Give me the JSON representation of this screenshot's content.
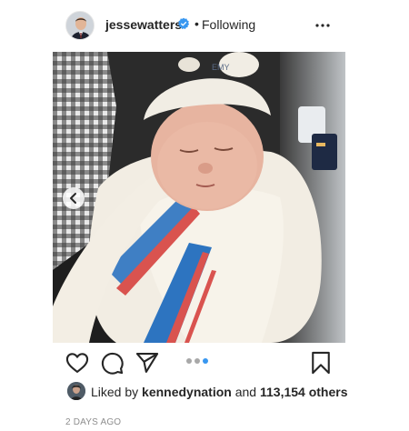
{
  "post": {
    "username": "jessewatters",
    "separator": "•",
    "follow_status": "Following",
    "more_icon": "more-horizontal-icon",
    "verified_icon": "verified-badge-icon"
  },
  "carousel": {
    "prev_icon": "chevron-left-icon",
    "current_index": 3,
    "total": 3
  },
  "actions": {
    "like_icon": "heart-icon",
    "comment_icon": "comment-icon",
    "share_icon": "share-icon",
    "save_icon": "bookmark-icon"
  },
  "likes": {
    "prefix": "Liked by",
    "liker": "kennedynation",
    "connector": "and",
    "count": "113,154 others"
  },
  "timestamp": "2 DAYS AGO",
  "colors": {
    "verified": "#3897f0",
    "active_dot": "#3897f0",
    "inactive_dot": "#a8a8a8",
    "text_secondary": "#8e8e8e"
  }
}
